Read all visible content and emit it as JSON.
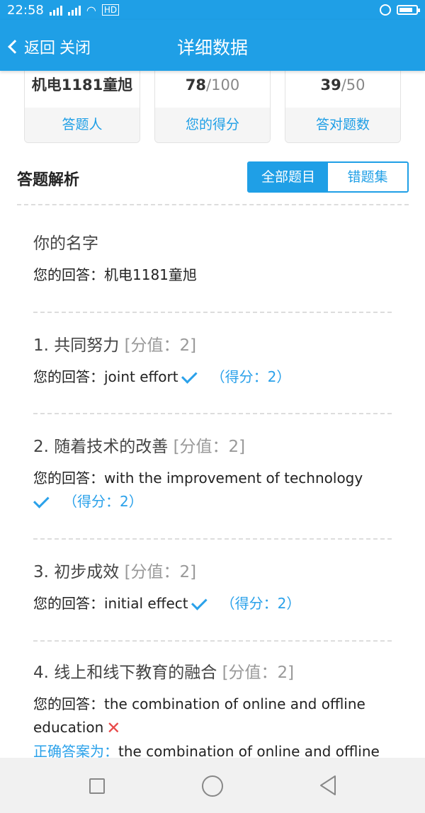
{
  "status": {
    "time": "22:58",
    "network_label": "HD"
  },
  "nav": {
    "back_label": "返回",
    "close_label": "关闭",
    "title": "详细数据"
  },
  "summary": [
    {
      "value": "机电1181童旭",
      "total": "",
      "label": "答题人"
    },
    {
      "value": "78",
      "total": "/100",
      "label": "您的得分"
    },
    {
      "value": "39",
      "total": "/50",
      "label": "答对题数"
    }
  ],
  "section": {
    "title": "答题解析",
    "tab_all": "全部题目",
    "tab_wrong": "错题集"
  },
  "answer_prefix": "您的回答：",
  "questions": [
    {
      "title": "你的名字",
      "score_text": "",
      "answer": "机电1181童旭",
      "status": "none",
      "got": ""
    },
    {
      "title": "1. 共同努力",
      "score_text": "[分值：2]",
      "answer": "joint effort",
      "status": "correct",
      "got": "（得分：2）"
    },
    {
      "title": "2. 随着技术的改善",
      "score_text": "[分值：2]",
      "answer": "with the improvement of technology",
      "status": "correct",
      "got": "（得分：2）"
    },
    {
      "title": "3. 初步成效",
      "score_text": "[分值：2]",
      "answer": "initial effect",
      "status": "correct",
      "got": "（得分：2）"
    },
    {
      "title": "4. 线上和线下教育的融合",
      "score_text": "[分值：2]",
      "answer": "the combination of online and offline education",
      "status": "wrong",
      "got": "",
      "correct_label": "正确答案为：",
      "correct_answer": "the combination of online and offline"
    }
  ],
  "colors": {
    "primary": "#1f9fe6",
    "check": "#2aa1ea",
    "wrong": "#e84a4a"
  }
}
